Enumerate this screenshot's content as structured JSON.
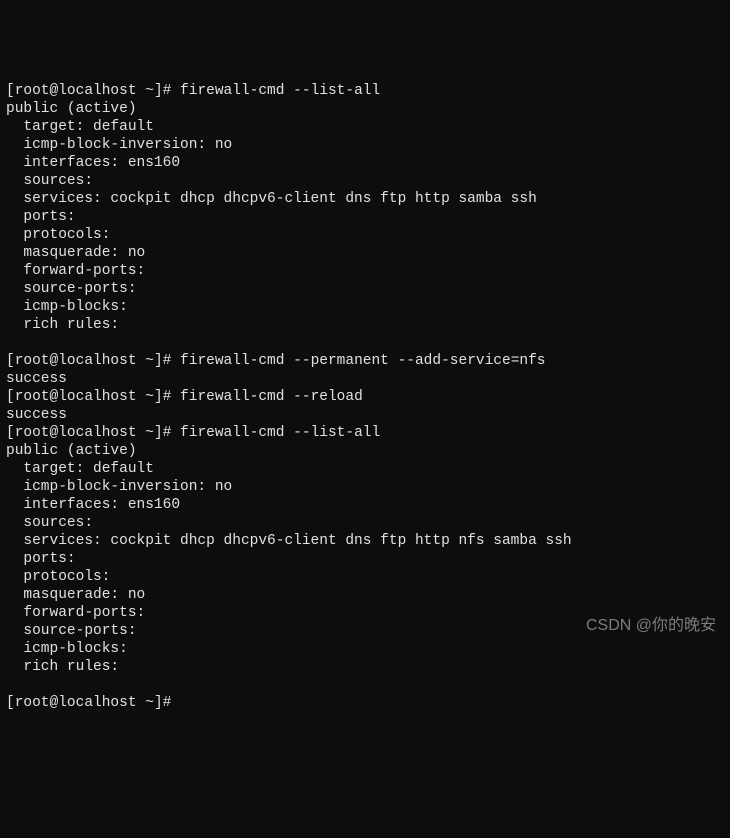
{
  "prompt": {
    "open": "[",
    "user": "root@localhost",
    "space": " ",
    "tilde": "~",
    "close": "]#",
    "trail": " "
  },
  "lines": [
    {
      "type": "cmd",
      "cmd": "firewall-cmd --list-all"
    },
    {
      "type": "out",
      "text": "public (active)"
    },
    {
      "type": "out",
      "text": "  target: default"
    },
    {
      "type": "out",
      "text": "  icmp-block-inversion: no"
    },
    {
      "type": "out",
      "text": "  interfaces: ens160"
    },
    {
      "type": "out",
      "text": "  sources:"
    },
    {
      "type": "out",
      "text": "  services: cockpit dhcp dhcpv6-client dns ftp http samba ssh"
    },
    {
      "type": "out",
      "text": "  ports:"
    },
    {
      "type": "out",
      "text": "  protocols:"
    },
    {
      "type": "out",
      "text": "  masquerade: no"
    },
    {
      "type": "out",
      "text": "  forward-ports:"
    },
    {
      "type": "out",
      "text": "  source-ports:"
    },
    {
      "type": "out",
      "text": "  icmp-blocks:"
    },
    {
      "type": "out",
      "text": "  rich rules:"
    },
    {
      "type": "out",
      "text": ""
    },
    {
      "type": "cmd",
      "cmd": "firewall-cmd --permanent --add-service=nfs"
    },
    {
      "type": "out",
      "text": "success"
    },
    {
      "type": "cmd",
      "cmd": "firewall-cmd --reload"
    },
    {
      "type": "out",
      "text": "success"
    },
    {
      "type": "cmd",
      "cmd": "firewall-cmd --list-all"
    },
    {
      "type": "out",
      "text": "public (active)"
    },
    {
      "type": "out",
      "text": "  target: default"
    },
    {
      "type": "out",
      "text": "  icmp-block-inversion: no"
    },
    {
      "type": "out",
      "text": "  interfaces: ens160"
    },
    {
      "type": "out",
      "text": "  sources:"
    },
    {
      "type": "out",
      "text": "  services: cockpit dhcp dhcpv6-client dns ftp http nfs samba ssh"
    },
    {
      "type": "out",
      "text": "  ports:"
    },
    {
      "type": "out",
      "text": "  protocols:"
    },
    {
      "type": "out",
      "text": "  masquerade: no"
    },
    {
      "type": "out",
      "text": "  forward-ports:"
    },
    {
      "type": "out",
      "text": "  source-ports:"
    },
    {
      "type": "out",
      "text": "  icmp-blocks:"
    },
    {
      "type": "out",
      "text": "  rich rules:"
    },
    {
      "type": "out",
      "text": ""
    },
    {
      "type": "cmd",
      "cmd": ""
    }
  ],
  "watermark": "CSDN @你的晚安"
}
